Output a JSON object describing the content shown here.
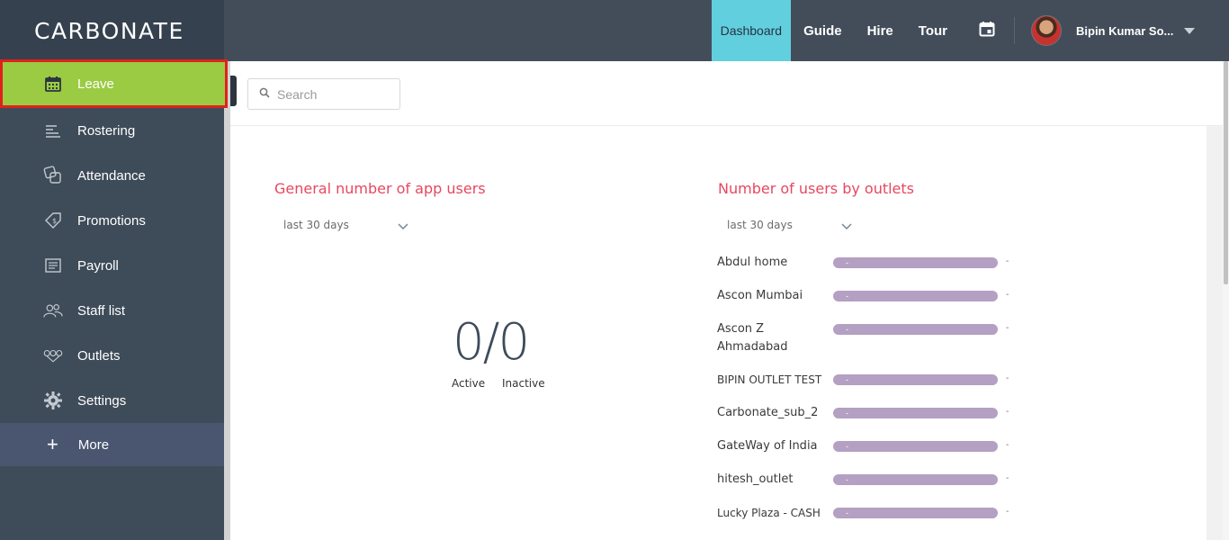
{
  "app": {
    "logo": "CARBONATE"
  },
  "sidebar": {
    "items": [
      {
        "label": "Leave",
        "icon": "calendar-icon",
        "active": true
      },
      {
        "label": "Rostering",
        "icon": "rostering-icon"
      },
      {
        "label": "Attendance",
        "icon": "attendance-icon"
      },
      {
        "label": "Promotions",
        "icon": "promotions-tag-icon"
      },
      {
        "label": "Payroll",
        "icon": "payroll-icon"
      },
      {
        "label": "Staff list",
        "icon": "staff-list-icon"
      },
      {
        "label": "Outlets",
        "icon": "outlets-icon"
      },
      {
        "label": "Settings",
        "icon": "gear-icon"
      }
    ],
    "more": {
      "label": "More",
      "icon": "plus-icon"
    }
  },
  "topnav": {
    "links": [
      "Dashboard",
      "Guide",
      "Hire",
      "Tour"
    ],
    "active": "Dashboard",
    "calendar_icon": "calendar-icon",
    "user_name": "Bipin Kumar So..."
  },
  "search": {
    "placeholder": "Search",
    "icon": "search-icon"
  },
  "panels": {
    "app_users": {
      "title": "General number of app users",
      "period": "last 30 days",
      "active_count": "0",
      "separator": "/",
      "inactive_count": "0",
      "active_label": "Active",
      "inactive_label": "Inactive"
    },
    "outlets": {
      "title": "Number of users by outlets",
      "period": "last 30 days",
      "rows": [
        {
          "name": "Abdul home",
          "bar": "-",
          "value": "-"
        },
        {
          "name": "Ascon Mumbai",
          "bar": "-",
          "value": "-"
        },
        {
          "name": "Ascon Z Ahmadabad",
          "bar": "-",
          "value": "-"
        },
        {
          "name": "BIPIN OUTLET TEST",
          "bar": "-",
          "value": "-"
        },
        {
          "name": "Carbonate_sub_2",
          "bar": "-",
          "value": "-"
        },
        {
          "name": "GateWay of India",
          "bar": "-",
          "value": "-"
        },
        {
          "name": "hitesh_outlet",
          "bar": "-",
          "value": "-"
        },
        {
          "name": "Lucky Plaza - CASH",
          "bar": "-",
          "value": "-"
        }
      ]
    }
  },
  "colors": {
    "sidebar_bg": "#3e4b59",
    "active_item": "#9bcb43",
    "highlight_border": "#e0211b",
    "dashboard_tab": "#62cfdf",
    "title_red": "#e8475f",
    "bar_purple": "#b4a0c2"
  }
}
